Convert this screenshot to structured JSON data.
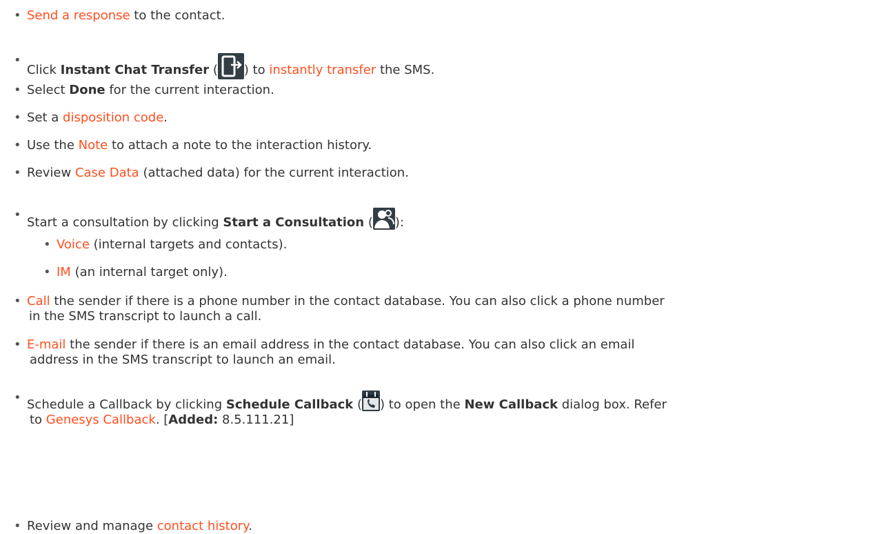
{
  "bullet": "•",
  "colors": {
    "link": "#ff4f1f",
    "text": "#333333",
    "icon_bg": "#333d44"
  },
  "items": {
    "response": {
      "link": "Send a response",
      "after": " to the contact."
    },
    "transfer": {
      "pre": "Click ",
      "bold": "Instant Chat Transfer",
      "open": " (",
      "close": ") to ",
      "link": "instantly transfer",
      "after": " the SMS.",
      "icon": "instant-chat-transfer-icon"
    },
    "done": {
      "pre": "Select ",
      "bold": "Done",
      "after": " for the current interaction."
    },
    "disposition": {
      "pre": "Set a ",
      "link": "disposition code",
      "after": "."
    },
    "note": {
      "pre": "Use the ",
      "link": "Note",
      "after": " to attach a note to the interaction history."
    },
    "casedata": {
      "pre": "Review ",
      "link": "Case Data",
      "after": " (attached data) for the current interaction."
    },
    "consult": {
      "pre": "Start a consultation by clicking ",
      "bold": "Start a Consultation",
      "open": " (",
      "close": "):",
      "icon": "start-consultation-icon"
    },
    "voice": {
      "link": "Voice",
      "after": " (internal targets and contacts)."
    },
    "im": {
      "link": "IM",
      "after": " (an internal target only)."
    },
    "call": {
      "link": "Call",
      "after": " the sender if there is a phone number in the contact database. You can also click a phone number",
      "line2": "in the SMS transcript to launch a call."
    },
    "email": {
      "link": "E-mail",
      "after": " the sender if there is an email address in the contact database. You can also click an email",
      "line2": "address in the SMS transcript to launch an email."
    },
    "callback": {
      "pre": "Schedule a Callback by clicking ",
      "bold": "Schedule Callback",
      "open": " (",
      "close": ") to open the ",
      "bold2": "New Callback",
      "after": " dialog box. Refer",
      "line2_pre": "to ",
      "link": "Genesys Callback",
      "line2_mid": ". [",
      "added": "Added:",
      "version": " 8.5.111.21]",
      "icon": "schedule-callback-icon"
    },
    "history": {
      "pre": "Review and manage ",
      "link": "contact history",
      "after": "."
    }
  }
}
